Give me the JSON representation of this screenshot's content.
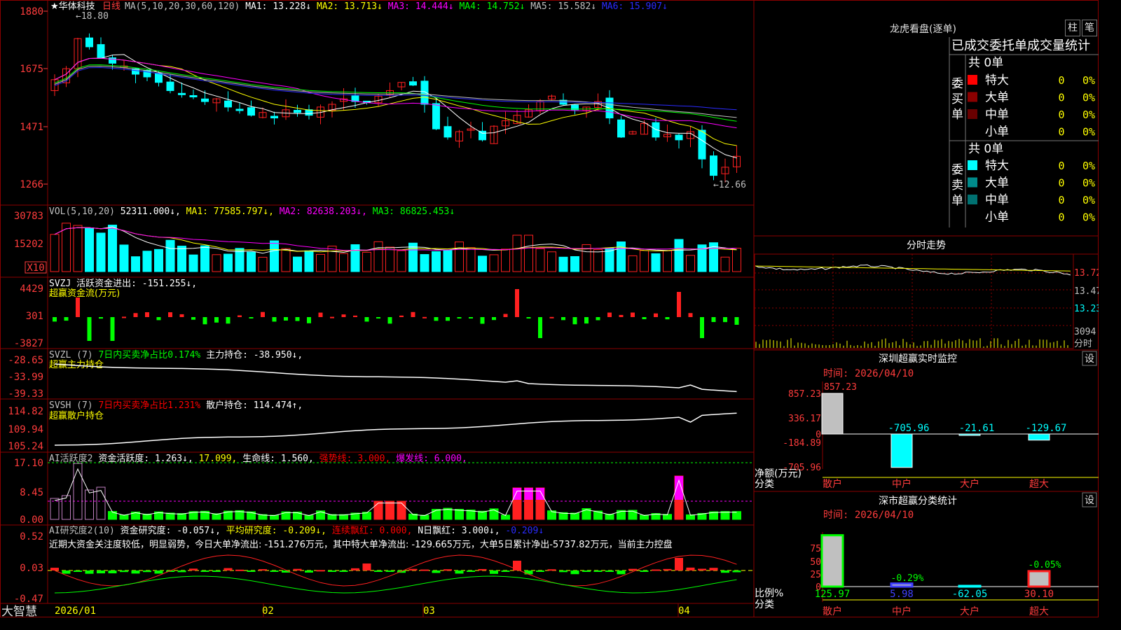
{
  "title": {
    "star": "★",
    "name": "华体科技",
    "period": "日线",
    "ma_label": "MA(5,10,20,30,60,120)",
    "ma_items": [
      {
        "text": "MA1: 13.228↓",
        "color": "#ffffff"
      },
      {
        "text": "MA2: 13.713↓",
        "color": "#ffff00"
      },
      {
        "text": "MA3: 14.444↓",
        "color": "#ff00ff"
      },
      {
        "text": "MA4: 14.752↓",
        "color": "#00ff00"
      },
      {
        "text": "MA5: 15.582↓",
        "color": "#c0c0c0"
      },
      {
        "text": "MA6: 15.907↓",
        "color": "#2b2bff"
      }
    ]
  },
  "price_panel": {
    "y_ticks": [
      "1880",
      "1675",
      "1471",
      "1266"
    ],
    "high_label": "←18.80",
    "low_label": "←12.66"
  },
  "vol_panel": {
    "header": [
      {
        "text": "VOL(5,10,20)",
        "color": "#c0c0c0"
      },
      {
        "text": " 52311.000↓,",
        "color": "#ffffff"
      },
      {
        "text": " MA1: 77585.797↓,",
        "color": "#ffff00"
      },
      {
        "text": " MA2: 82638.203↓,",
        "color": "#ff00ff"
      },
      {
        "text": " MA3: 86825.453↓",
        "color": "#00ff00"
      }
    ],
    "y_ticks": [
      "30783",
      "15202"
    ],
    "unit": "X10"
  },
  "svzj_panel": {
    "line1": "SVZJ  活跃资金进出: -151.255↓,",
    "line2": "超赢资金流(万元)",
    "y_ticks": [
      "4429",
      "301",
      "-3827"
    ]
  },
  "svzl_panel": {
    "header": [
      {
        "text": "SVZL (7) ",
        "color": "#c0c0c0"
      },
      {
        "text": "7日内买卖净占比0.174%",
        "color": "#00ff00"
      },
      {
        "text": " 主力持仓: -38.950↓,",
        "color": "#ffffff"
      }
    ],
    "line2": "超赢主力持仓",
    "y_ticks": [
      "-28.65",
      "-33.99",
      "-39.33"
    ]
  },
  "svsh_panel": {
    "header": [
      {
        "text": "SVSH (7) ",
        "color": "#c0c0c0"
      },
      {
        "text": "7日内买卖净占比1.231%",
        "color": "#ff0000"
      },
      {
        "text": " 散户持仓: 114.474↑,",
        "color": "#ffffff"
      }
    ],
    "line2": "超赢散户持仓",
    "y_ticks": [
      "114.82",
      "109.94",
      "105.24"
    ]
  },
  "ai1_panel": {
    "header": [
      {
        "text": "AI活跃度2 ",
        "color": "#c0c0c0"
      },
      {
        "text": "资金活跃度: 1.263↓,",
        "color": "#ffffff"
      },
      {
        "text": " 17.099,",
        "color": "#ffff00"
      },
      {
        "text": " 生命线: 1.560,",
        "color": "#ffffff"
      },
      {
        "text": " 强势线: 3.000,",
        "color": "#ff0000"
      },
      {
        "text": " 爆发线: 6.000,",
        "color": "#ff00ff"
      }
    ],
    "y_ticks": [
      "17.10",
      "8.45",
      "0.00"
    ]
  },
  "ai2_panel": {
    "header": [
      {
        "text": "AI研究度2(10) ",
        "color": "#c0c0c0"
      },
      {
        "text": "资金研究度: -0.057↓,",
        "color": "#ffffff"
      },
      {
        "text": " 平均研究度: -0.209↓,",
        "color": "#ffff00"
      },
      {
        "text": " 连续飘红: 0.000,",
        "color": "#ff0000"
      },
      {
        "text": " N日飘红: 3.000↓,",
        "color": "#ffffff"
      },
      {
        "text": " -0.209↓",
        "color": "#2b2bff"
      }
    ],
    "comment": "近期大资金关注度较低，明显弱势，今日大单净流出: -151.276万元，其中特大单净流出: -129.665万元，大单5日累计净出-5737.82万元，当前主力控盘",
    "y_ticks": [
      "0.52",
      "0.03",
      "-0.47"
    ]
  },
  "x_axis": {
    "brand": "大智慧",
    "labels": [
      "2026/01",
      "02",
      "03",
      "04"
    ]
  },
  "lhb": {
    "title": "龙虎看盘(逐单)",
    "btn1": "柱",
    "btn2": "笔",
    "header": "已成交委托单成交量统计",
    "buy_label": "委买单",
    "sell_label": "委卖单",
    "buy_total": "共 0单",
    "sell_total": "共 0单",
    "buy_rows": [
      {
        "label": "特大",
        "value": "0",
        "pct": "0%",
        "color": "#ff0000"
      },
      {
        "label": "大单",
        "value": "0",
        "pct": "0%",
        "color": "#8b0000"
      },
      {
        "label": "中单",
        "value": "0",
        "pct": "0%",
        "color": "#6a0000"
      },
      {
        "label": "小单",
        "value": "0",
        "pct": "0%",
        "color": ""
      }
    ],
    "sell_rows": [
      {
        "label": "特大",
        "value": "0",
        "pct": "0%",
        "color": "#00ffff"
      },
      {
        "label": "大单",
        "value": "0",
        "pct": "0%",
        "color": "#008b8b"
      },
      {
        "label": "中单",
        "value": "0",
        "pct": "0%",
        "color": "#007070"
      },
      {
        "label": "小单",
        "value": "0",
        "pct": "0%",
        "color": ""
      }
    ]
  },
  "minute": {
    "title": "分时走势",
    "ticks": [
      "13.72",
      "13.47",
      "13.23",
      "3094"
    ],
    "vol_label": "分时"
  },
  "monitor": {
    "title": "深圳超赢实时监控",
    "btn": "设",
    "time": "时间: 2026/04/10",
    "ticks": [
      "857.23",
      "336.17",
      "0",
      "-184.89",
      "-705.96"
    ],
    "net_label": "净额(万元)",
    "cat_label": "分类",
    "chart_data": {
      "type": "bar",
      "categories": [
        "散户",
        "中户",
        "大户",
        "超大"
      ],
      "values": [
        857.23,
        -705.96,
        -21.61,
        -129.67
      ],
      "value_labels": [
        "857.23",
        "-705.96",
        "-21.61",
        "-129.67"
      ]
    }
  },
  "classify": {
    "title": "深市超赢分类统计",
    "btn": "设",
    "time": "时间: 2026/04/10",
    "ticks": [
      "75",
      "50",
      "25",
      "0"
    ],
    "ratio_label": "比例%",
    "cat_label": "分类",
    "chart_data": {
      "type": "bar",
      "categories": [
        "散户",
        "中户",
        "大户",
        "超大"
      ],
      "values": [
        125.97,
        5.98,
        -62.05,
        30.1
      ],
      "pos_labels": [
        "",
        "-0.29%",
        "",
        "-0.05%"
      ],
      "bottom_labels": [
        "125.97",
        "5.98",
        "-62.05",
        "30.10"
      ]
    }
  },
  "colors": {
    "up": "#ff2020",
    "down": "#00ffff",
    "grid": "#8b0000",
    "tick": "#ff3c3c"
  }
}
